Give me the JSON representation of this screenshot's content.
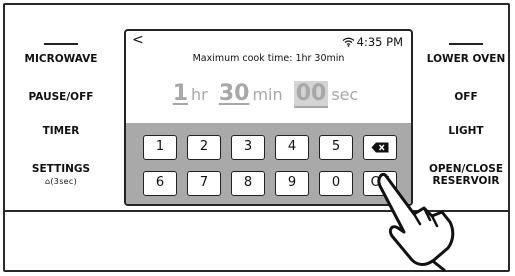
{
  "left_buttons": [
    {
      "label": "MICROWAVE"
    },
    {
      "label": "PAUSE/OFF"
    },
    {
      "label": "TIMER"
    },
    {
      "label": "SETTINGS",
      "sub": "⌂(3sec)"
    }
  ],
  "right_buttons": [
    {
      "label": "LOWER OVEN"
    },
    {
      "label": "OFF"
    },
    {
      "label": "LIGHT"
    },
    {
      "label": "OPEN/CLOSE",
      "label2": "RESERVOIR"
    }
  ],
  "screen": {
    "back_glyph": "<",
    "time": "4:35 PM",
    "max_text": "Maximum cook time: 1hr 30min",
    "hours": "1",
    "hours_unit": "hr",
    "minutes": "30",
    "minutes_unit": "min",
    "seconds": "00",
    "seconds_unit": "sec"
  },
  "keypad": {
    "row1": [
      "1",
      "2",
      "3",
      "4",
      "5"
    ],
    "row2": [
      "6",
      "7",
      "8",
      "9",
      "0"
    ],
    "ok": "OK",
    "delete_icon": "backspace-icon"
  },
  "icons": [
    "wifi-icon",
    "back-arrow-icon",
    "backspace-icon",
    "pointing-hand-icon",
    "lock-icon"
  ]
}
